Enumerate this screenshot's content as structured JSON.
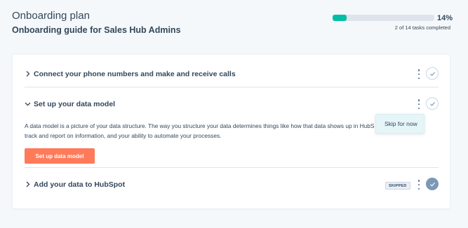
{
  "header": {
    "title": "Onboarding plan",
    "subtitle": "Onboarding guide for Sales Hub Admins",
    "progress_fraction": 0.14,
    "progress_percent_label": "14%",
    "progress_caption": "2 of 14 tasks completed"
  },
  "tasks": [
    {
      "title": "Connect your phone numbers and make and receive calls",
      "expanded": false,
      "status": "incomplete"
    },
    {
      "title": "Set up your data model",
      "expanded": true,
      "status": "incomplete",
      "description": "A data model is a picture of your data structure. The way you structure your data determines things like how that data shows up in HubS track and report on information, and your ability to automate your processes.",
      "button_label": "Set up data model"
    },
    {
      "title": "Add your data to HubSpot",
      "expanded": false,
      "status": "skipped",
      "badge": "SKIPPED"
    }
  ],
  "menu": {
    "items": [
      "Skip for now"
    ]
  },
  "colors": {
    "accent": "#ff7a59",
    "progress": "#00bda5",
    "text": "#33475b",
    "menu_bg": "#e5f5f8"
  },
  "icons": {
    "collapsed": "chevron-right-icon",
    "expanded": "chevron-down-icon",
    "more": "kebab-icon",
    "complete": "check-icon"
  }
}
